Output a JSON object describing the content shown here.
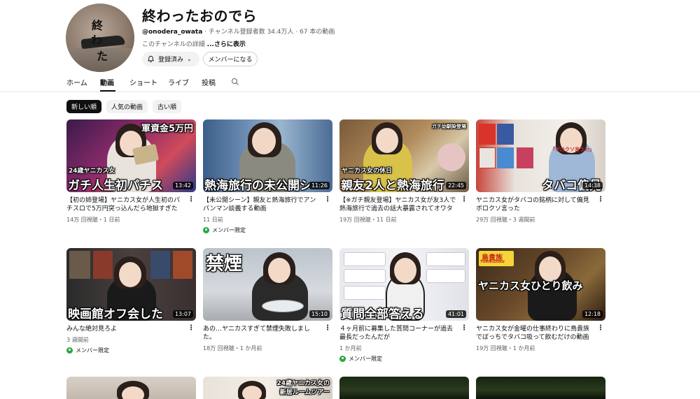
{
  "channel": {
    "title": "終わったおのでら",
    "handle": "@onodera_owata",
    "meta": " · チャンネル登録者数 34.4万人 · 67 本の動画",
    "description": "このチャンネルの詳細 ",
    "description_more": "...さらに表示",
    "avatar_text": [
      "終",
      "わ",
      "た"
    ],
    "subscribe_label": "登録済み",
    "member_label": "メンバーになる"
  },
  "tabs": [
    "ホーム",
    "動画",
    "ショート",
    "ライブ",
    "投稿"
  ],
  "chips": [
    "新しい順",
    "人気の動画",
    "古い順"
  ],
  "member_badge": "メンバー限定",
  "videos": [
    {
      "overlay_top": "軍資金5万円",
      "overlay_small": "24歳ヤニカス女",
      "overlay_main": "ガチ人生初パチス",
      "duration": "13:42",
      "title": "【初の姉登場】ヤニカス女が人生初のパチスロで5万円突っ込んだら地獄すぎた",
      "meta": "14万 回視聴・1 日前",
      "member": false
    },
    {
      "overlay_main": "熱海旅行の未公開シ",
      "duration": "11:26",
      "title": "【未公開シーン】親友と熱海旅行でアンパンマン談義する動画",
      "meta": "11 日前",
      "member": true
    },
    {
      "overlay_top": "ガチ幼馴染登場",
      "overlay_small": "ヤニカス女の休日",
      "overlay_main": "親友2人と熱海旅行",
      "duration": "22:45",
      "title": "【※ガチ親友登場】ヤニカス女が友3人で熱海旅行で過去の話大暴露されてオワタ",
      "meta": "19万 回視聴・11 日前",
      "member": false
    },
    {
      "overlay_top": "「ボロクソ言うわ」",
      "overlay_main": "タバコ偏見",
      "duration": "14:38",
      "title": "ヤニカス女がタバコの銘柄に対して偏見ボロクソ言った",
      "meta": "29万 回視聴・3 週間前",
      "member": false
    },
    {
      "overlay_main": "映画館オフ会した",
      "duration": "13:07",
      "title": "みんな絶対見ろよ",
      "meta": "3 週間前",
      "member": true
    },
    {
      "overlay_top": "禁煙",
      "duration": "15:10",
      "title": "あの…ヤニカスすぎて禁煙失敗しました。",
      "meta": "18万 回視聴・1 か月前",
      "member": false
    },
    {
      "overlay_main": "質問全部答える",
      "duration": "41:01",
      "title": "４ヶ月前に募集した質問コーナーが過去最長だったんだが",
      "meta": "1 か月前",
      "member": true
    },
    {
      "overlay_top": "鳥貴族",
      "overlay_top2": "TORIKIZOKU",
      "overlay_main": "ヤニカス女ひとり飲み",
      "duration": "12:18",
      "title": "ヤニカス女が金曜の仕事終わりに鳥貴族でぼっちでタバコ吸って飲むだけの動画",
      "meta": "19万 回視聴・1 か月前",
      "member": false
    },
    {
      "title": ""
    },
    {
      "overlay_top": "24歳ヤニカス女の",
      "overlay_top2": "新居ルームツアー",
      "title": ""
    },
    {
      "title": ""
    },
    {
      "title": ""
    }
  ]
}
